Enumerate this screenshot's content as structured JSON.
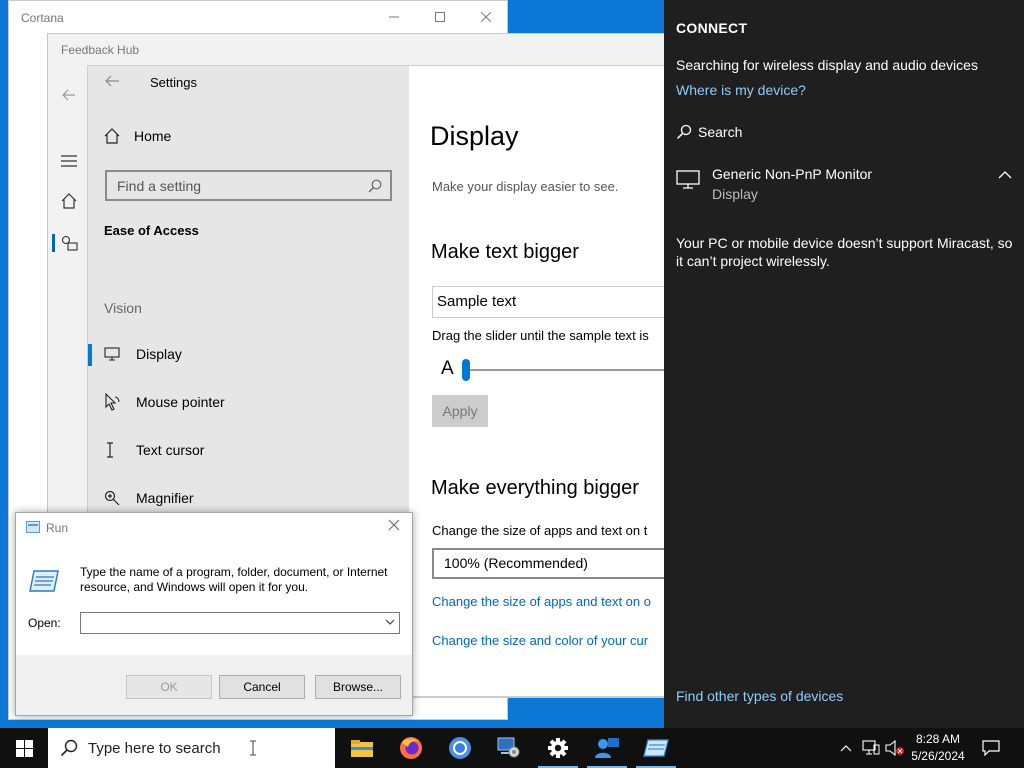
{
  "cortana": {
    "title": "Cortana"
  },
  "feedback_hub": {
    "title": "Feedback Hub"
  },
  "settings": {
    "title": "Settings",
    "home_label": "Home",
    "search_placeholder": "Find a setting",
    "group_heading": "Ease of Access",
    "section_label": "Vision",
    "nav_items": [
      {
        "label": "Display",
        "icon": "monitor-icon",
        "active": true
      },
      {
        "label": "Mouse pointer",
        "icon": "mouse-pointer-icon",
        "active": false
      },
      {
        "label": "Text cursor",
        "icon": "text-cursor-icon",
        "active": false
      },
      {
        "label": "Magnifier",
        "icon": "magnifier-icon",
        "active": false
      }
    ],
    "main": {
      "heading": "Display",
      "subtitle": "Make your display easier to see.",
      "text_bigger_heading": "Make text bigger",
      "sample_text": "Sample text",
      "slider_hint": "Drag the slider until the sample text is",
      "slider_letter": "A",
      "apply_label": "Apply",
      "everything_bigger_heading": "Make everything bigger",
      "scale_label": "Change the size of apps and text on t",
      "scale_value": "100% (Recommended)",
      "link_1": "Change the size of apps and text on o",
      "link_2": "Change the size and color of your cur"
    }
  },
  "run_dialog": {
    "title": "Run",
    "message": "Type the name of a program, folder, document, or Internet resource, and Windows will open it for you.",
    "open_label": "Open:",
    "open_value": "",
    "ok_label": "OK",
    "cancel_label": "Cancel",
    "browse_label": "Browse..."
  },
  "connect_panel": {
    "heading": "CONNECT",
    "searching_text": "Searching for wireless display and audio devices",
    "where_link": "Where is my device?",
    "search_label": "Search",
    "device_name": "Generic Non-PnP Monitor",
    "device_type": "Display",
    "note": "Your PC or mobile device doesn’t support Miracast, so it can’t project wirelessly.",
    "find_link": "Find other types of devices"
  },
  "taskbar": {
    "search_placeholder": "Type here to search",
    "apps": [
      {
        "icon": "file-explorer-icon",
        "open": false
      },
      {
        "icon": "firefox-icon",
        "open": false
      },
      {
        "icon": "chrome-icon",
        "open": false
      },
      {
        "icon": "control-panel-icon",
        "open": false
      },
      {
        "icon": "settings-gear-icon",
        "open": true
      },
      {
        "icon": "feedback-hub-icon",
        "open": true
      },
      {
        "icon": "run-icon",
        "open": true
      }
    ],
    "time": "8:28 AM",
    "date": "5/26/2024"
  },
  "colors": {
    "accent": "#0078d4",
    "link_dark_panel": "#8ecdf8",
    "desktop": "#0a78d4"
  }
}
